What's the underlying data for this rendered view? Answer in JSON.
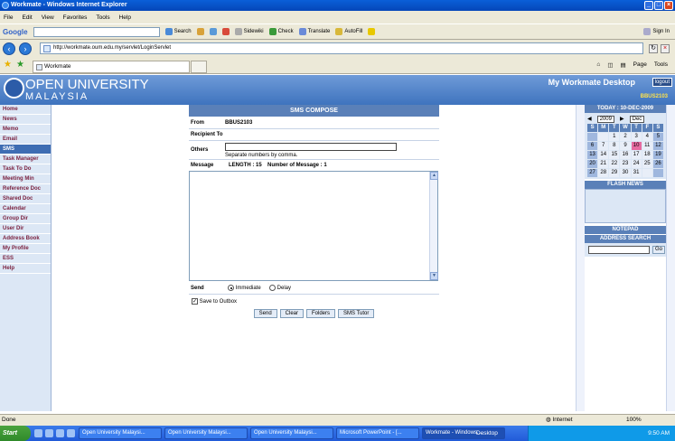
{
  "window": {
    "title": "Workmate - Windows Internet Explorer"
  },
  "menu": [
    "File",
    "Edit",
    "View",
    "Favorites",
    "Tools",
    "Help"
  ],
  "toolbar": {
    "logo": "Google",
    "search": "Search",
    "sidewiki": "Sidewiki",
    "check": "Check",
    "translate": "Translate",
    "autofill": "AutoFill",
    "signin": "Sign In"
  },
  "address": {
    "url": "http://workmate.oum.edu.my/servlet/LoginServlet"
  },
  "tab": {
    "label": "Workmate"
  },
  "commands": {
    "page": "Page",
    "tools": "Tools"
  },
  "banner": {
    "line1": "OPEN UNIVERSITY",
    "line2": "MALAYSIA",
    "desktop": "My Workmate Desktop",
    "logout": "logout",
    "user": "BBUS2103"
  },
  "sidebar": [
    {
      "label": "Home"
    },
    {
      "label": "News"
    },
    {
      "label": "Memo"
    },
    {
      "label": "Email"
    },
    {
      "label": "SMS",
      "active": true
    },
    {
      "label": "Task Manager"
    },
    {
      "label": "Task To Do"
    },
    {
      "label": "Meeting Min"
    },
    {
      "label": "Reference Doc"
    },
    {
      "label": "Shared Doc"
    },
    {
      "label": "Calendar"
    },
    {
      "label": "Group Dir"
    },
    {
      "label": "User Dir"
    },
    {
      "label": "Address Book"
    },
    {
      "label": "My Profile"
    },
    {
      "label": "ESS"
    },
    {
      "label": "Help"
    }
  ],
  "compose": {
    "title": "SMS COMPOSE",
    "from_label": "From",
    "from_value": "BBUS2103",
    "recipient_label": "Recipient To",
    "others_label": "Others",
    "others_hint": "Separate numbers by comma.",
    "message_label": "Message",
    "length_text": "LENGTH : 15",
    "count_text": "Number of Message : 1",
    "send_label": "Send",
    "immediate": "Immediate",
    "delay": "Delay",
    "save_outbox": "Save to Outbox",
    "buttons": [
      "Send",
      "Clear",
      "Folders",
      "SMS Tutor"
    ]
  },
  "calendar": {
    "header": "TODAY : 10-DEC-2009",
    "year": "2009",
    "month": "Dec",
    "days": [
      "S",
      "M",
      "T",
      "W",
      "T",
      "F",
      "S"
    ],
    "rows": [
      [
        "",
        "",
        "1",
        "2",
        "3",
        "4",
        "5"
      ],
      [
        "6",
        "7",
        "8",
        "9",
        "10",
        "11",
        "12"
      ],
      [
        "13",
        "14",
        "15",
        "16",
        "17",
        "18",
        "19"
      ],
      [
        "20",
        "21",
        "22",
        "23",
        "24",
        "25",
        "26"
      ],
      [
        "27",
        "28",
        "29",
        "30",
        "31",
        "",
        ""
      ]
    ],
    "today": "10"
  },
  "flash": {
    "title": "FLASH NEWS"
  },
  "notepad": {
    "title": "NOTEPAD"
  },
  "addr_search": {
    "title": "ADDRESS SEARCH",
    "go": "Go"
  },
  "status": {
    "text": "Done",
    "zone": "Internet",
    "zoom": "100%"
  },
  "taskbar": {
    "start": "Start",
    "tasks": [
      "Open University Malaysi...",
      "Open University Malaysi...",
      "Open University Malaysi...",
      "Microsoft PowerPoint - [...",
      "Workmate - Windows..."
    ],
    "desktop": "Desktop",
    "time": "9:50 AM"
  }
}
